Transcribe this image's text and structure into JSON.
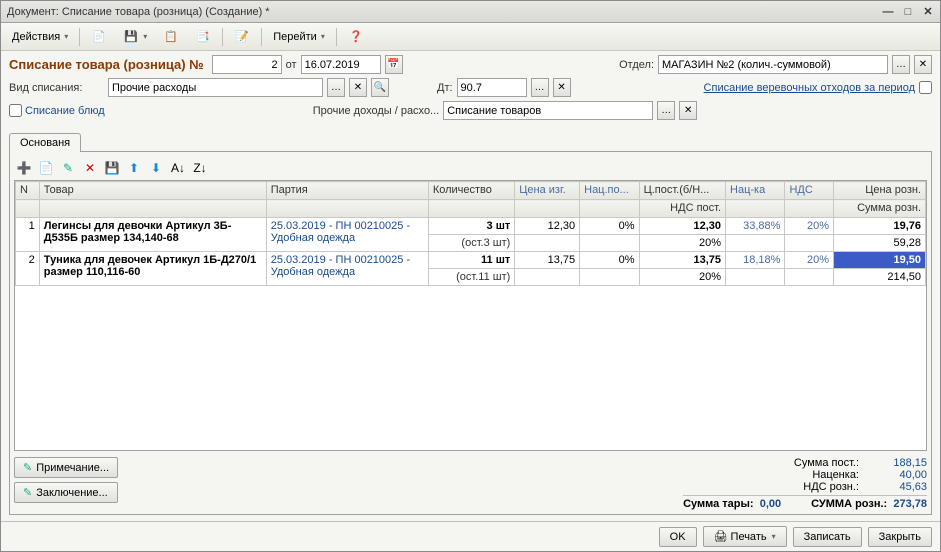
{
  "titlebar": "Документ: Списание товара (розница) (Создание) *",
  "toolbar": {
    "actions": "Действия",
    "goto": "Перейти"
  },
  "header": {
    "doc_title": "Списание товара (розница) №",
    "doc_num": "2",
    "date_lbl": "от",
    "date": "16.07.2019",
    "dept_lbl": "Отдел:",
    "dept": "МАГАЗИН №2 (колич.-суммовой)",
    "writeoff_type_lbl": "Вид списания:",
    "writeoff_type": "Прочие расходы",
    "dt_lbl": "Дт:",
    "dt": "90.7",
    "period_link": "Списание веревочных отходов за период",
    "dishes_label": "Списание блюд",
    "other_income_lbl": "Прочие доходы / расхо...",
    "other_income": "Списание товаров"
  },
  "tab": "Основаня",
  "grid": {
    "cols": {
      "n": "N",
      "product": "Товар",
      "batch": "Партия",
      "qty": "Количество",
      "mfr_price": "Цена изг.",
      "nac_po": "Нац.по...",
      "cost_nb": "Ц.пост.(б/Н...",
      "nacka": "Нац-ка",
      "nds": "НДС",
      "retail_price": "Цена розн.",
      "nds_post": "НДС пост.",
      "sum_retail": "Сумма розн."
    },
    "rows": [
      {
        "n": "1",
        "product": "Легинсы для девочки  Артикул 3Б-Д535Б размер 134,140-68",
        "batch": "25.03.2019 - ПН 00210025 - Удобная одежда",
        "qty": "3 шт",
        "ost": "(ост.3 шт)",
        "mfr_price": "12,30",
        "nac_po": "0%",
        "cost_nb": "12,30",
        "nds_post_pct": "20%",
        "nacka": "33,88%",
        "nds": "20%",
        "retail_price": "19,76",
        "sum_retail": "59,28"
      },
      {
        "n": "2",
        "product": "Туника для девочек Артикул 1Б-Д270/1 размер 110,116-60",
        "batch": "25.03.2019 - ПН 00210025 - Удобная одежда",
        "qty": "11 шт",
        "ost": "(ост.11 шт)",
        "mfr_price": "13,75",
        "nac_po": "0%",
        "cost_nb": "13,75",
        "nds_post_pct": "20%",
        "nacka": "18,18%",
        "nds": "20%",
        "retail_price": "19,50",
        "sum_retail": "214,50"
      }
    ]
  },
  "buttons": {
    "note": "Примечание...",
    "conclusion": "Заключение..."
  },
  "totals": {
    "sum_post_lbl": "Сумма пост.:",
    "sum_post": "188,15",
    "markup_lbl": "Наценка:",
    "markup": "40,00",
    "nds_retail_lbl": "НДС розн.:",
    "nds_retail": "45,63",
    "tare_lbl": "Сумма тары:",
    "tare": "0,00",
    "sum_retail_lbl": "СУММА розн.:",
    "sum_retail": "273,78"
  },
  "footer": {
    "ok": "OK",
    "print": "Печать",
    "save": "Записать",
    "close": "Закрыть"
  }
}
